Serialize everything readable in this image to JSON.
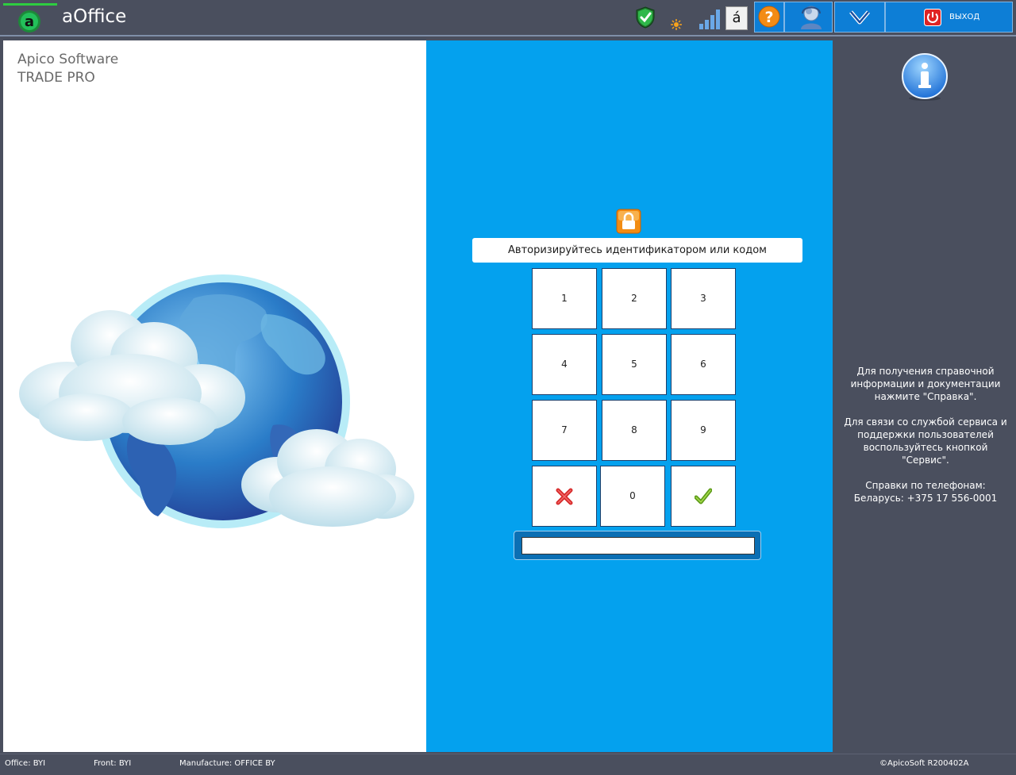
{
  "app": {
    "title": "aOffice",
    "logo_letter": "a"
  },
  "toolbar": {
    "exit_label": "ВЫХОД",
    "lang_glyph": "á"
  },
  "brand": {
    "line1": "Apico Software",
    "line2": "TRADE PRO"
  },
  "auth": {
    "prompt": "Авторизируйтесь идентификатором или кодом",
    "code_value": "",
    "keys": [
      "1",
      "2",
      "3",
      "4",
      "5",
      "6",
      "7",
      "8",
      "9",
      "0"
    ]
  },
  "help": {
    "paragraph1": "Для получения справочной информации и документации нажмите \"Справка\".",
    "paragraph2": "Для связи со службой сервиса и поддержки пользователей воспользуйтесь кнопкой \"Сервис\".",
    "phones_title": "Справки по телефонам:",
    "phones_line": "Беларусь: +375 17 556-0001"
  },
  "status": {
    "office": "Office: BYI",
    "front": "Front: BYI",
    "manufacture": "Manufacture: OFFICE BY",
    "copyright": "©ApicoSoft R200402A"
  },
  "colors": {
    "chrome": "#4a4f5e",
    "accent_blue": "#04a1ee",
    "button_blue": "#0d7ed6",
    "green_stripe": "#2ecc40"
  }
}
